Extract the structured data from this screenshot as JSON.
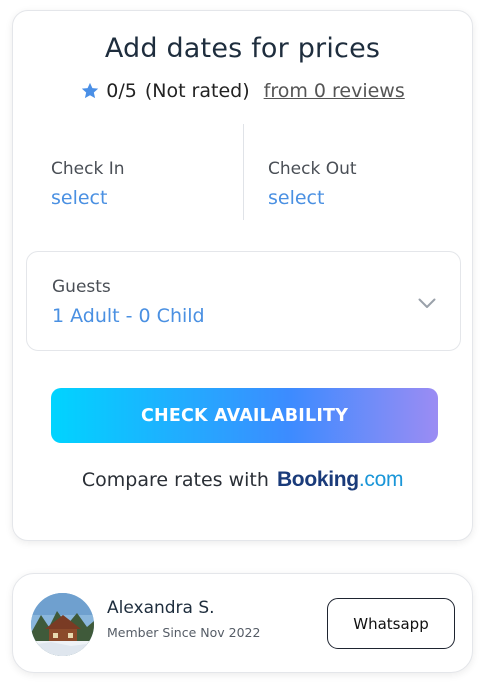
{
  "booking": {
    "title": "Add dates for prices",
    "rating": "0/5",
    "rating_note": "(Not rated)",
    "reviews_link": "from 0 reviews",
    "check_in_label": "Check In",
    "check_in_value": "select",
    "check_out_label": "Check Out",
    "check_out_value": "select",
    "guests_label": "Guests",
    "guests_value": "1 Adult - 0 Child",
    "cta_label": "CHECK AVAILABILITY",
    "compare_text": "Compare rates with",
    "booking_brand_main": "Booking",
    "booking_brand_suffix": ".com"
  },
  "host": {
    "name": "Alexandra S.",
    "member_since": "Member Since Nov 2022",
    "contact_button": "Whatsapp"
  },
  "icons": {
    "rating": "star-icon",
    "guests_dropdown": "chevron-down-icon",
    "avatar": "avatar-photo"
  },
  "colors": {
    "accent_text": "#4a90e2",
    "star": "#4a8fe6",
    "cta_gradient": [
      "#00d4ff",
      "#3d8bff",
      "#9b8cf3"
    ],
    "booking_dark": "#1a3b7a",
    "booking_light": "#1a96d8"
  }
}
